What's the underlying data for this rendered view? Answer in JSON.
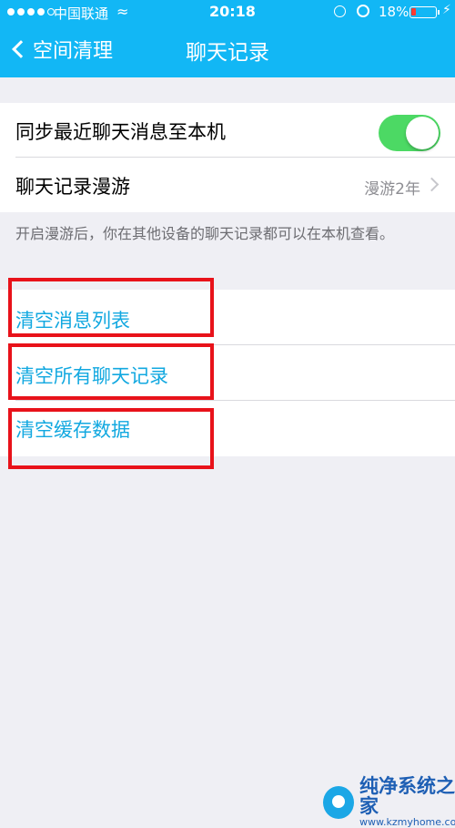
{
  "status_bar": {
    "carrier": "中国联通",
    "time": "20:18",
    "battery_percent": "18%",
    "battery_level": 0.18
  },
  "nav": {
    "back_label": "空间清理",
    "title": "聊天记录"
  },
  "settings": {
    "sync_label": "同步最近聊天消息至本机",
    "sync_enabled": true,
    "roaming_label": "聊天记录漫游",
    "roaming_value": "漫游2年",
    "roaming_note": "开启漫游后，你在其他设备的聊天记录都可以在本机查看。"
  },
  "actions": [
    {
      "label": "清空消息列表"
    },
    {
      "label": "清空所有聊天记录"
    },
    {
      "label": "清空缓存数据"
    }
  ],
  "colors": {
    "nav_bg": "#12b7f5",
    "toggle_on": "#4cd964",
    "action_text": "#12a8e0",
    "highlight_border": "#e8121a"
  },
  "watermark": {
    "name": "纯净系统之家",
    "url": "www.kzmyhome.com"
  }
}
